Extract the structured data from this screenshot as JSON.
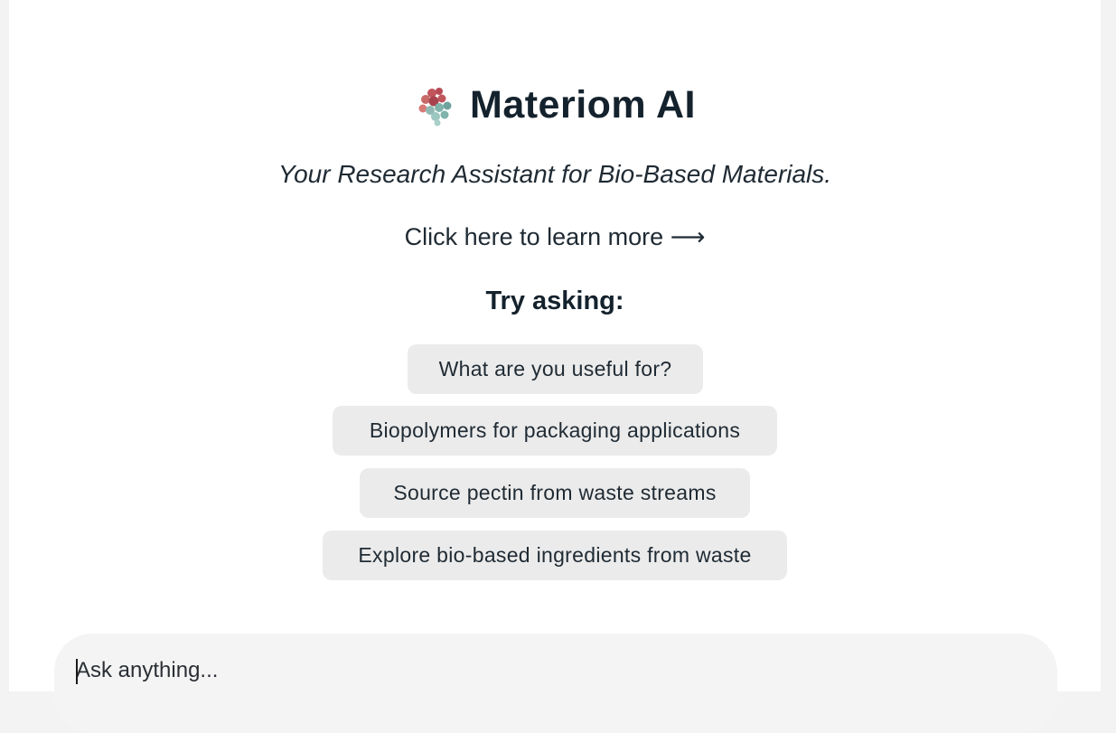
{
  "header": {
    "logo_icon": "molecule-cluster-logo",
    "title": "Materiom AI"
  },
  "intro": {
    "tagline": "Your Research Assistant for Bio-Based Materials.",
    "learn_more": "Click here to learn more ⟶"
  },
  "suggestions": {
    "heading": "Try asking:",
    "items": [
      {
        "label": "What are you useful for?"
      },
      {
        "label": "Biopolymers for packaging applications"
      },
      {
        "label": "Source pectin from waste streams"
      },
      {
        "label": "Explore bio-based ingredients from waste"
      }
    ]
  },
  "composer": {
    "placeholder": "Ask anything...",
    "value": ""
  },
  "colors": {
    "page_background": "#f3f3f3",
    "panel_background": "#ffffff",
    "text_dark": "#14222d",
    "chip_background": "#ebebeb",
    "logo_red": "#c0555c",
    "logo_teal": "#7fb3ab"
  }
}
